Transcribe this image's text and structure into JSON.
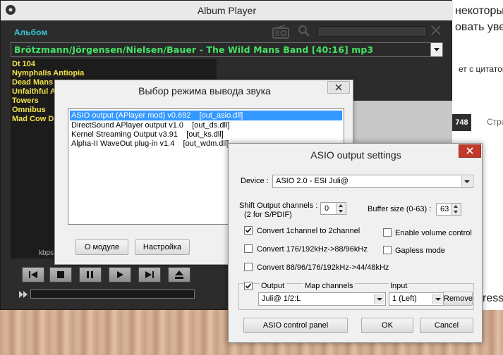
{
  "background": {
    "snippets": [
      "некоторых с",
      "овать уве",
      "ет с цитатой",
      "Стра",
      "ress"
    ],
    "tab_number": "748"
  },
  "player": {
    "title": "Album Player",
    "album_label": "Альбом",
    "album_selected": "Brötzmann/Jörgensen/Nielsen/Bauer - The Wild Mans Band  [40:16]  mp3",
    "tracks": [
      "Dt 104",
      "Nymphalis Antiopia",
      "Dead Mans",
      "Unfaithful A",
      "Towers",
      "Omnibus",
      "Mad Cow D"
    ],
    "kbps_label": "kbps"
  },
  "output_selector": {
    "title": "Выбор режима вывода звука",
    "items": [
      "ASIO output (APlayer mod) v0.692    [out_asio.dll]",
      "DirectSound APlayer output v1.0    [out_ds.dll]",
      "Kernel Streaming Output v3.91    [out_ks.dll]",
      "Alpha-II WaveOut plug-in v1.4    [out_wdm.dll]"
    ],
    "about_label": "О модуле",
    "setup_label": "Настройка"
  },
  "asio": {
    "title": "ASIO output settings",
    "device_label": "Device :",
    "device_value": "ASIO 2.0 - ESI Juli@",
    "shift_label": "Shift Output channels :",
    "shift_sub": "(2 for S/PDIF)",
    "shift_value": "0",
    "buffer_label": "Buffer size (0-63) :",
    "buffer_value": "63",
    "convert_1to2": "Convert 1channel to 2channel",
    "enable_volume": "Enable volume control",
    "convert_176": "Convert 176/192kHz->88/96kHz",
    "gapless": "Gapless mode",
    "convert_88": "Convert 88/96/176/192kHz->44/48kHz",
    "output_label": "Output",
    "map_label": "Map channels",
    "input_label": "Input",
    "output_value": "Juli@ 1/2:L",
    "input_value": "1 (Left)",
    "remove_label": "Remove",
    "control_panel_label": "ASIO control panel",
    "ok_label": "OK",
    "cancel_label": "Cancel",
    "checks": {
      "convert_1to2": true,
      "enable_volume": false,
      "convert_176": false,
      "gapless": false,
      "convert_88": false,
      "map_channels": true
    }
  }
}
